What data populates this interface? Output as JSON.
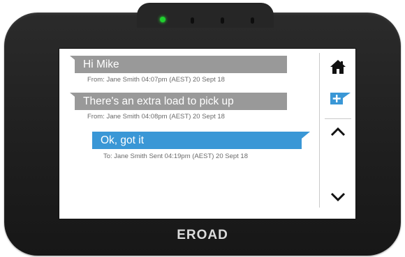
{
  "device": {
    "brand": "EROAD"
  },
  "messages": [
    {
      "direction": "incoming",
      "text": "Hi Mike",
      "meta": "From: Jane Smith 04:07pm (AEST) 20 Sept 18"
    },
    {
      "direction": "incoming",
      "text": "There's an extra load to pick up",
      "meta": "From: Jane Smith 04:08pm (AEST) 20 Sept 18"
    },
    {
      "direction": "outgoing",
      "text": "Ok, got it",
      "meta": "To: Jane Smith Sent 04:19pm (AEST) 20 Sept 18"
    }
  ],
  "sidebar": {
    "icons": [
      "home-icon",
      "new-message-icon",
      "chevron-up-icon",
      "chevron-down-icon"
    ]
  },
  "colors": {
    "incoming_bubble": "#999999",
    "outgoing_bubble": "#3a97d6",
    "device_body": "#1e1e1e",
    "status_led": "#1fd12e"
  }
}
